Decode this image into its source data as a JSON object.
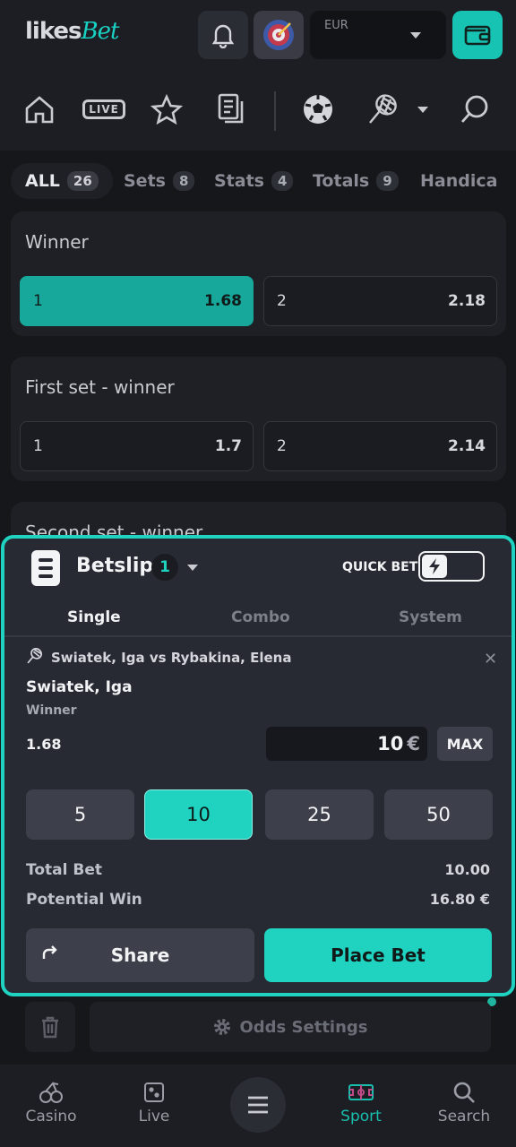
{
  "header": {
    "logo_part1": "likes",
    "logo_part2": "Bet",
    "currency_label": "EUR"
  },
  "nav_icons": [
    "home-icon",
    "live-icon",
    "star-icon",
    "document-icon",
    "soccer-ball-icon",
    "tennis-racket-icon",
    "chevron-down-icon",
    "search-icon"
  ],
  "nav_live_label": "LIVE",
  "market_tabs": [
    {
      "label": "ALL",
      "count": "26"
    },
    {
      "label": "Sets",
      "count": "8"
    },
    {
      "label": "Stats",
      "count": "4"
    },
    {
      "label": "Totals",
      "count": "9"
    },
    {
      "label": "Handica",
      "count": ""
    }
  ],
  "markets": [
    {
      "title": "Winner",
      "odds": [
        {
          "name": "1",
          "value": "1.68",
          "selected": true
        },
        {
          "name": "2",
          "value": "2.18",
          "selected": false
        }
      ]
    },
    {
      "title": "First set - winner",
      "odds": [
        {
          "name": "1",
          "value": "1.7",
          "selected": false
        },
        {
          "name": "2",
          "value": "2.14",
          "selected": false
        }
      ]
    },
    {
      "title": "Second set - winner",
      "odds": []
    }
  ],
  "betslip": {
    "title": "Betslip",
    "count": "1",
    "quick_bet_label": "QUICK BET",
    "quick_bet_on": false,
    "tabs": [
      "Single",
      "Combo",
      "System"
    ],
    "active_tab": "Single",
    "event": "Swiatek, Iga vs Rybakina, Elena",
    "selection": "Swiatek, Iga",
    "market": "Winner",
    "odds": "1.68",
    "stake": "10",
    "stake_currency": "€",
    "max_label": "MAX",
    "quick_stakes": [
      "5",
      "10",
      "25",
      "50"
    ],
    "selected_quick_stake": "10",
    "total_bet_label": "Total Bet",
    "total_bet_value": "10.00",
    "potential_win_label": "Potential Win",
    "potential_win_value": "16.80 €",
    "share_label": "Share",
    "place_bet_label": "Place Bet"
  },
  "footer_actions": {
    "odds_settings_label": "Odds Settings"
  },
  "bottom_nav": [
    {
      "label": "Casino",
      "icon": "cherries-icon",
      "active": false
    },
    {
      "label": "Live",
      "icon": "dice-icon",
      "active": false
    },
    {
      "label": "Sport",
      "icon": "stadium-icon",
      "active": true
    },
    {
      "label": "Search",
      "icon": "search-icon",
      "active": false
    }
  ],
  "colors": {
    "accent": "#1fd3c0",
    "selected_odd": "#17a89b",
    "background": "#16171b"
  }
}
